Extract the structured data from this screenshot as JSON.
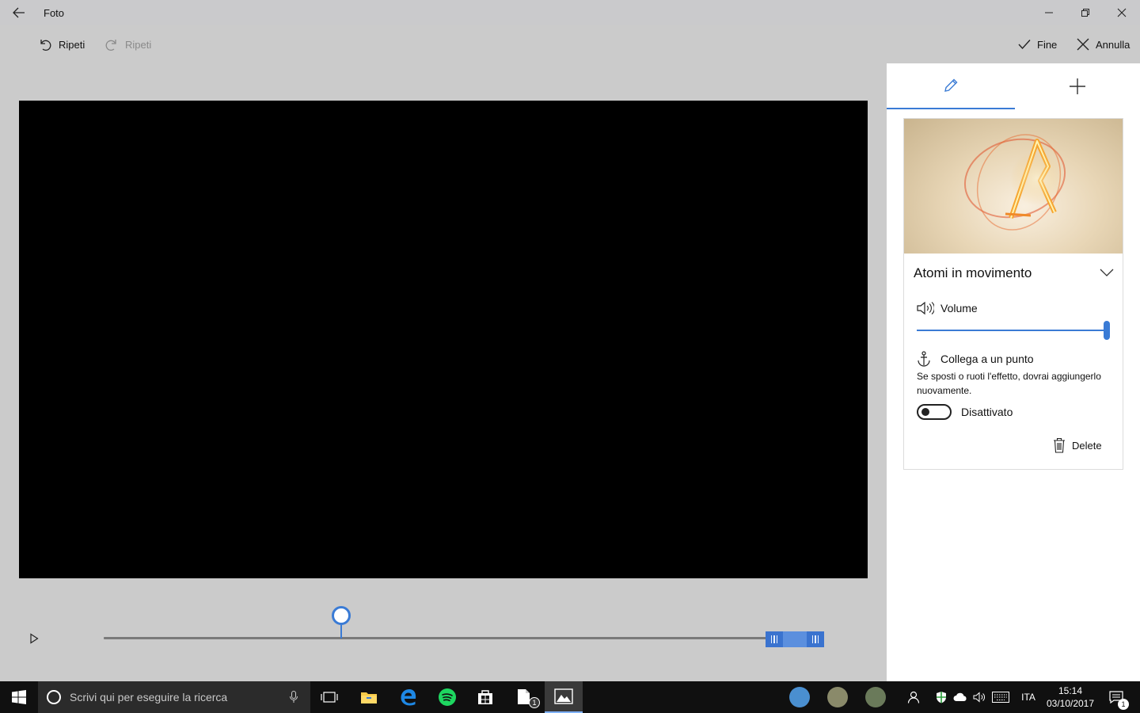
{
  "app": {
    "title": "Foto"
  },
  "toolbar": {
    "undo_label": "Ripeti",
    "redo_label": "Ripeti",
    "done_label": "Fine",
    "cancel_label": "Annulla"
  },
  "panel": {
    "tabs": [
      {
        "icon": "pencil-icon",
        "active": true
      },
      {
        "icon": "plus-icon",
        "active": false
      }
    ],
    "effect": {
      "name": "Atomi in movimento",
      "volume_label": "Volume",
      "volume_level": 1.0,
      "anchor_label": "Collega a un punto",
      "anchor_description": "Se sposti o ruoti l'effetto, dovrai aggiungerlo nuovamente.",
      "toggle_state_label": "Disattivato",
      "toggle_on": false,
      "delete_label": "Delete"
    }
  },
  "timeline": {
    "playhead_position": 0.33,
    "range_start": 0.92,
    "range_end": 1.0
  },
  "taskbar": {
    "search_placeholder": "Scrivi qui per eseguire la ricerca",
    "language": "ITA",
    "time": "15:14",
    "date": "03/10/2017",
    "notification_count": "1",
    "files_badge": "1"
  },
  "colors": {
    "accent": "#3a7bd5",
    "background": "#cbcbcb",
    "taskbar": "#101010"
  }
}
